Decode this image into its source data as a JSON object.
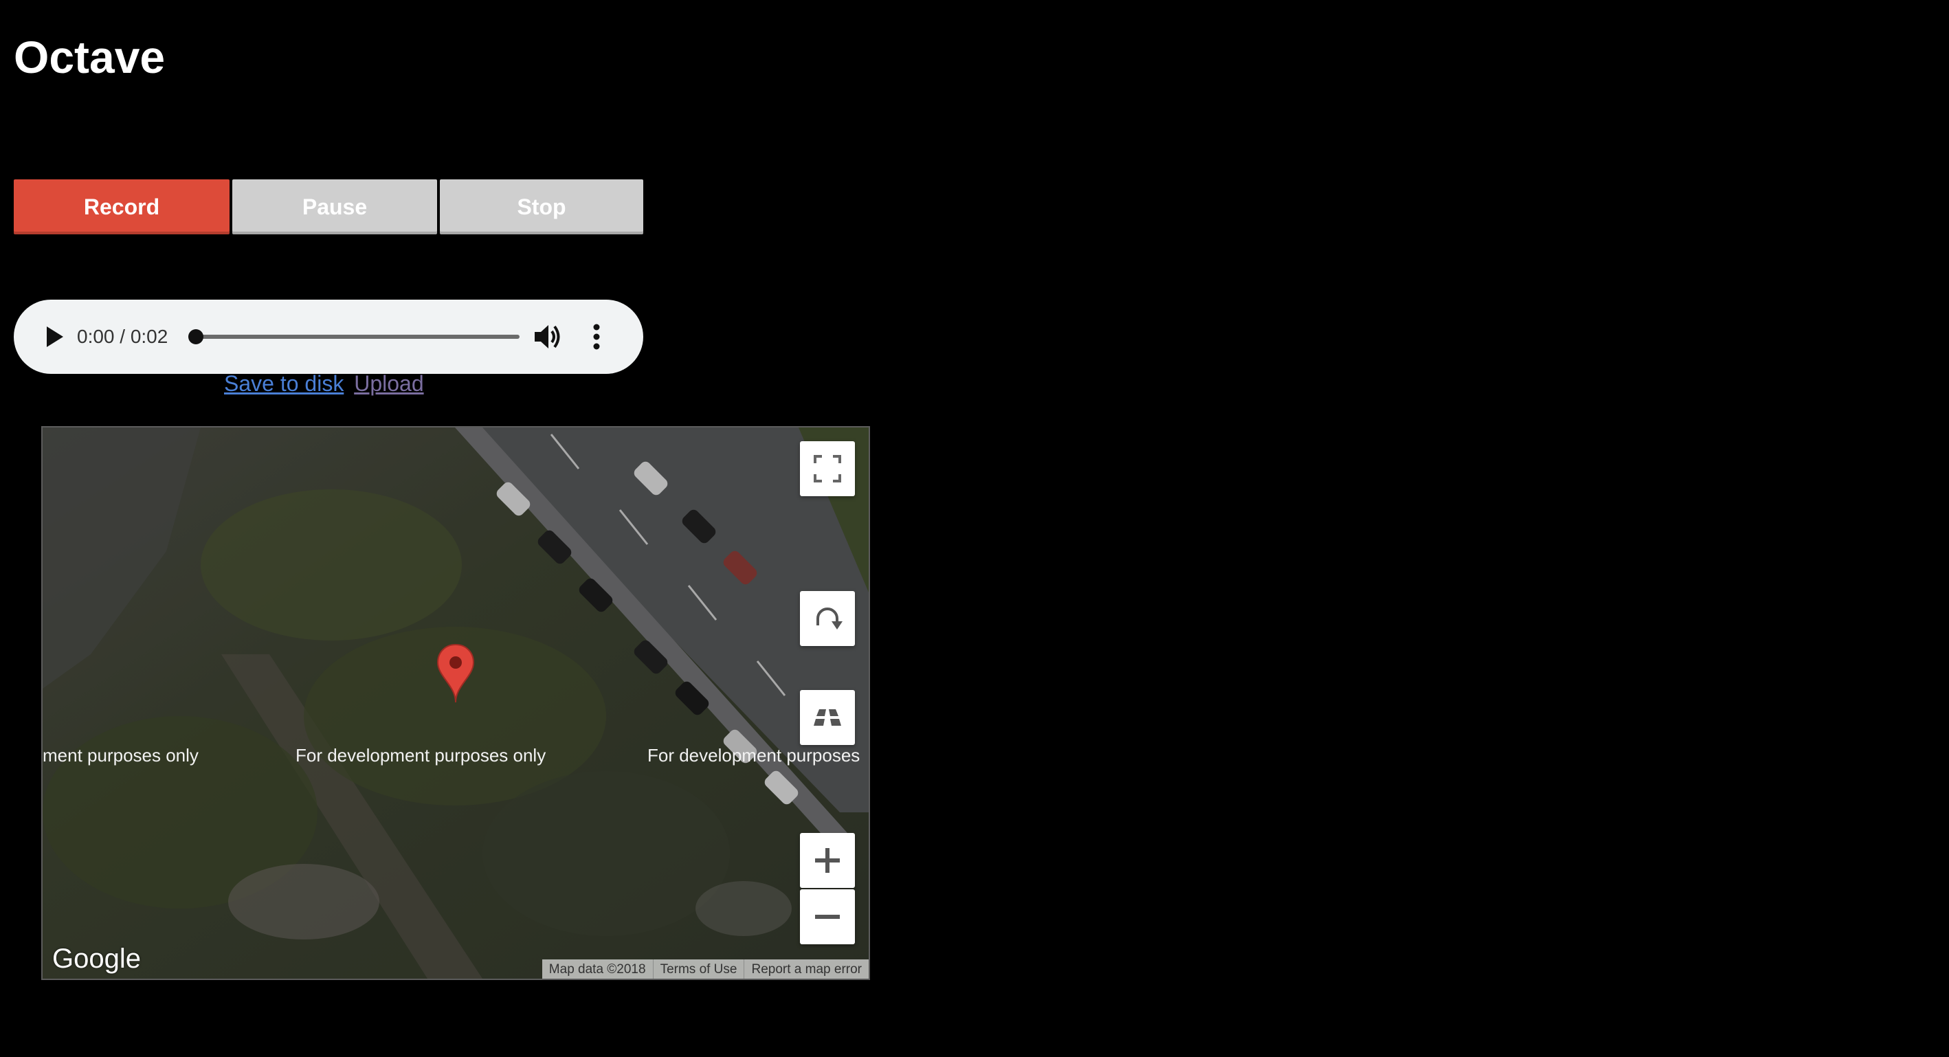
{
  "app": {
    "title": "Octave"
  },
  "controls": {
    "record_label": "Record",
    "pause_label": "Pause",
    "stop_label": "Stop"
  },
  "player": {
    "time": "0:00 / 0:02",
    "progress": 0
  },
  "links": {
    "save": "Save to disk",
    "upload": "Upload"
  },
  "map": {
    "watermark": "For development purposes only",
    "watermark_left": "ment purposes only",
    "watermark_right": "For development purposes",
    "logo": "Google",
    "attribution": [
      "Map data ©2018",
      "Terms of Use",
      "Report a map error"
    ],
    "icons": [
      "fullscreen-icon",
      "rotate-icon",
      "tilt-icon",
      "zoom-in-icon",
      "zoom-out-icon",
      "map-marker-icon"
    ]
  },
  "colors": {
    "record": "#dd4b39",
    "disabled": "#cfcfcf",
    "background": "#000000",
    "link": "#4a7fd6"
  }
}
